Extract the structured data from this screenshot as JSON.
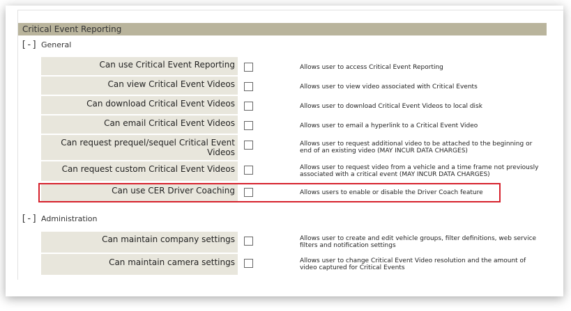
{
  "section": {
    "title": "Critical Event Reporting"
  },
  "groups": [
    {
      "toggle": "[-]",
      "title": "General",
      "permissions": [
        {
          "label": "Can use Critical Event Reporting",
          "description": "Allows user to access Critical Event Reporting",
          "checked": false
        },
        {
          "label": "Can view Critical Event Videos",
          "description": "Allows user to view video associated with Critical Events",
          "checked": false
        },
        {
          "label": "Can download Critical Event Videos",
          "description": "Allows user to download Critical Event Videos to local disk",
          "checked": false
        },
        {
          "label": "Can email Critical Event Videos",
          "description": "Allows user to email a hyperlink to a Critical Event Video",
          "checked": false
        },
        {
          "label": "Can request prequel/sequel Critical Event Videos",
          "description": "Allows user to request additional video to be attached to the beginning or end of an existing video (MAY INCUR DATA CHARGES)",
          "checked": false
        },
        {
          "label": "Can request custom Critical Event Videos",
          "description": "Allows user to request video from a vehicle and a time frame not previously associated with a critical event (MAY INCUR DATA CHARGES)",
          "checked": false
        },
        {
          "label": "Can use CER Driver Coaching",
          "description": "Allows users to enable or disable the Driver Coach feature",
          "checked": false,
          "highlighted": true
        }
      ]
    },
    {
      "toggle": "[-]",
      "title": "Administration",
      "permissions": [
        {
          "label": "Can maintain company settings",
          "description": "Allows user to create and edit vehicle groups, filter definitions, web service filters and notification settings",
          "checked": false
        },
        {
          "label": "Can maintain camera settings",
          "description": "Allows user to change Critical Event Video resolution and the amount of video captured for Critical Events",
          "checked": false
        }
      ]
    }
  ],
  "colors": {
    "header_bg": "#b9b49c",
    "label_bg": "#e8e6dc",
    "highlight_border": "#d6202b"
  }
}
